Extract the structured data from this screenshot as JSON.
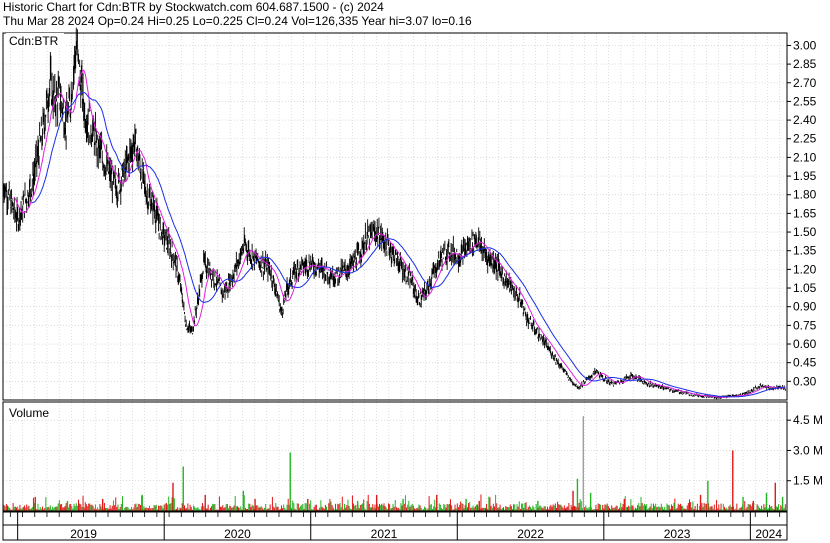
{
  "header": {
    "title": "Historic Chart for Cdn:BTR by Stockwatch.com 604.687.1500 - (c) 2024",
    "stats": "Thu Mar 28 2024   Op=0.24   Hi=0.25   Lo=0.225   Cl=0.24   Vol=126,335   Year hi=3.07   lo=0.16"
  },
  "chart_data": {
    "type": "line",
    "symbol_label": "Cdn:BTR",
    "volume_label": "Volume",
    "x_tick_labels": [
      "2019",
      "2020",
      "2021",
      "2022",
      "2023",
      "2024"
    ],
    "x_range": [
      2018.9,
      2024.25
    ],
    "year_starts": [
      2019,
      2020,
      2021,
      2022,
      2023,
      2024
    ],
    "price_axis": {
      "ylim": [
        0.15,
        3.1
      ],
      "ticks": [
        3.0,
        2.85,
        2.7,
        2.55,
        2.4,
        2.25,
        2.1,
        1.95,
        1.8,
        1.65,
        1.5,
        1.35,
        1.2,
        1.05,
        0.9,
        0.75,
        0.6,
        0.45,
        0.3
      ]
    },
    "volume_axis": {
      "ylim": [
        0,
        5.4
      ],
      "ticks": [
        4.5,
        3.0,
        1.5
      ],
      "tick_labels": [
        "4.5 M",
        "3.0 M",
        "1.5 M"
      ]
    },
    "price_anchors": [
      [
        2018.9,
        1.9
      ],
      [
        2018.95,
        1.75
      ],
      [
        2019.0,
        1.6
      ],
      [
        2019.05,
        1.75
      ],
      [
        2019.1,
        1.9
      ],
      [
        2019.17,
        2.3
      ],
      [
        2019.22,
        2.7
      ],
      [
        2019.25,
        2.55
      ],
      [
        2019.29,
        2.6
      ],
      [
        2019.33,
        2.35
      ],
      [
        2019.36,
        2.55
      ],
      [
        2019.38,
        2.8
      ],
      [
        2019.4,
        3.0
      ],
      [
        2019.43,
        2.7
      ],
      [
        2019.46,
        2.45
      ],
      [
        2019.5,
        2.35
      ],
      [
        2019.54,
        2.2
      ],
      [
        2019.58,
        2.1
      ],
      [
        2019.63,
        1.95
      ],
      [
        2019.68,
        1.85
      ],
      [
        2019.75,
        2.05
      ],
      [
        2019.8,
        2.25
      ],
      [
        2019.84,
        2.0
      ],
      [
        2019.88,
        1.8
      ],
      [
        2019.93,
        1.7
      ],
      [
        2019.98,
        1.5
      ],
      [
        2020.03,
        1.4
      ],
      [
        2020.08,
        1.25
      ],
      [
        2020.12,
        1.0
      ],
      [
        2020.15,
        0.75
      ],
      [
        2020.19,
        0.7
      ],
      [
        2020.23,
        0.95
      ],
      [
        2020.27,
        1.25
      ],
      [
        2020.31,
        1.2
      ],
      [
        2020.36,
        1.1
      ],
      [
        2020.4,
        1.0
      ],
      [
        2020.45,
        1.1
      ],
      [
        2020.5,
        1.25
      ],
      [
        2020.55,
        1.4
      ],
      [
        2020.6,
        1.3
      ],
      [
        2020.66,
        1.25
      ],
      [
        2020.72,
        1.2
      ],
      [
        2020.76,
        1.05
      ],
      [
        2020.8,
        0.85
      ],
      [
        2020.84,
        1.05
      ],
      [
        2020.9,
        1.2
      ],
      [
        2021.0,
        1.25
      ],
      [
        2021.08,
        1.2
      ],
      [
        2021.16,
        1.15
      ],
      [
        2021.25,
        1.2
      ],
      [
        2021.32,
        1.3
      ],
      [
        2021.38,
        1.45
      ],
      [
        2021.45,
        1.5
      ],
      [
        2021.52,
        1.4
      ],
      [
        2021.58,
        1.3
      ],
      [
        2021.63,
        1.2
      ],
      [
        2021.69,
        1.1
      ],
      [
        2021.73,
        0.95
      ],
      [
        2021.78,
        1.0
      ],
      [
        2021.83,
        1.15
      ],
      [
        2021.89,
        1.3
      ],
      [
        2021.95,
        1.35
      ],
      [
        2022.02,
        1.3
      ],
      [
        2022.08,
        1.4
      ],
      [
        2022.13,
        1.45
      ],
      [
        2022.2,
        1.3
      ],
      [
        2022.26,
        1.25
      ],
      [
        2022.31,
        1.15
      ],
      [
        2022.37,
        1.05
      ],
      [
        2022.43,
        0.95
      ],
      [
        2022.48,
        0.8
      ],
      [
        2022.54,
        0.7
      ],
      [
        2022.6,
        0.6
      ],
      [
        2022.66,
        0.5
      ],
      [
        2022.72,
        0.4
      ],
      [
        2022.78,
        0.3
      ],
      [
        2022.83,
        0.25
      ],
      [
        2022.89,
        0.32
      ],
      [
        2022.95,
        0.38
      ],
      [
        2023.0,
        0.32
      ],
      [
        2023.06,
        0.28
      ],
      [
        2023.12,
        0.3
      ],
      [
        2023.18,
        0.35
      ],
      [
        2023.24,
        0.32
      ],
      [
        2023.3,
        0.28
      ],
      [
        2023.38,
        0.26
      ],
      [
        2023.46,
        0.23
      ],
      [
        2023.54,
        0.21
      ],
      [
        2023.62,
        0.19
      ],
      [
        2023.7,
        0.18
      ],
      [
        2023.78,
        0.17
      ],
      [
        2023.86,
        0.18
      ],
      [
        2023.93,
        0.19
      ],
      [
        2024.0,
        0.22
      ],
      [
        2024.08,
        0.27
      ],
      [
        2024.14,
        0.24
      ],
      [
        2024.2,
        0.26
      ],
      [
        2024.24,
        0.24
      ]
    ],
    "volume_spikes_millions": [
      [
        2019.12,
        0.7
      ],
      [
        2019.34,
        0.5
      ],
      [
        2019.58,
        0.6
      ],
      [
        2019.85,
        0.8
      ],
      [
        2020.06,
        1.4
      ],
      [
        2020.13,
        2.2
      ],
      [
        2020.28,
        0.8
      ],
      [
        2020.54,
        1.0
      ],
      [
        2020.62,
        0.6
      ],
      [
        2020.86,
        2.9
      ],
      [
        2020.98,
        0.6
      ],
      [
        2021.32,
        0.5
      ],
      [
        2021.45,
        0.8
      ],
      [
        2021.63,
        0.6
      ],
      [
        2021.86,
        0.8
      ],
      [
        2022.06,
        0.6
      ],
      [
        2022.15,
        0.5
      ],
      [
        2022.55,
        0.5
      ],
      [
        2022.79,
        1.0
      ],
      [
        2022.82,
        1.6
      ],
      [
        2022.86,
        4.7
      ],
      [
        2022.91,
        0.9
      ],
      [
        2023.14,
        0.6
      ],
      [
        2023.48,
        0.4
      ],
      [
        2023.66,
        0.8
      ],
      [
        2023.71,
        1.5
      ],
      [
        2023.88,
        3.0
      ],
      [
        2023.95,
        0.7
      ],
      [
        2024.02,
        0.5
      ],
      [
        2024.11,
        0.9
      ],
      [
        2024.17,
        1.4
      ],
      [
        2024.22,
        0.7
      ]
    ],
    "colors": {
      "price_bars": "#000000",
      "ma_short": "#e020e0",
      "ma_long": "#1a2ee8",
      "volume_up": "#22b422",
      "volume_down": "#e01818",
      "volume_spike_grey": "#a0a0a0",
      "grid": "#c8c8c8"
    }
  }
}
